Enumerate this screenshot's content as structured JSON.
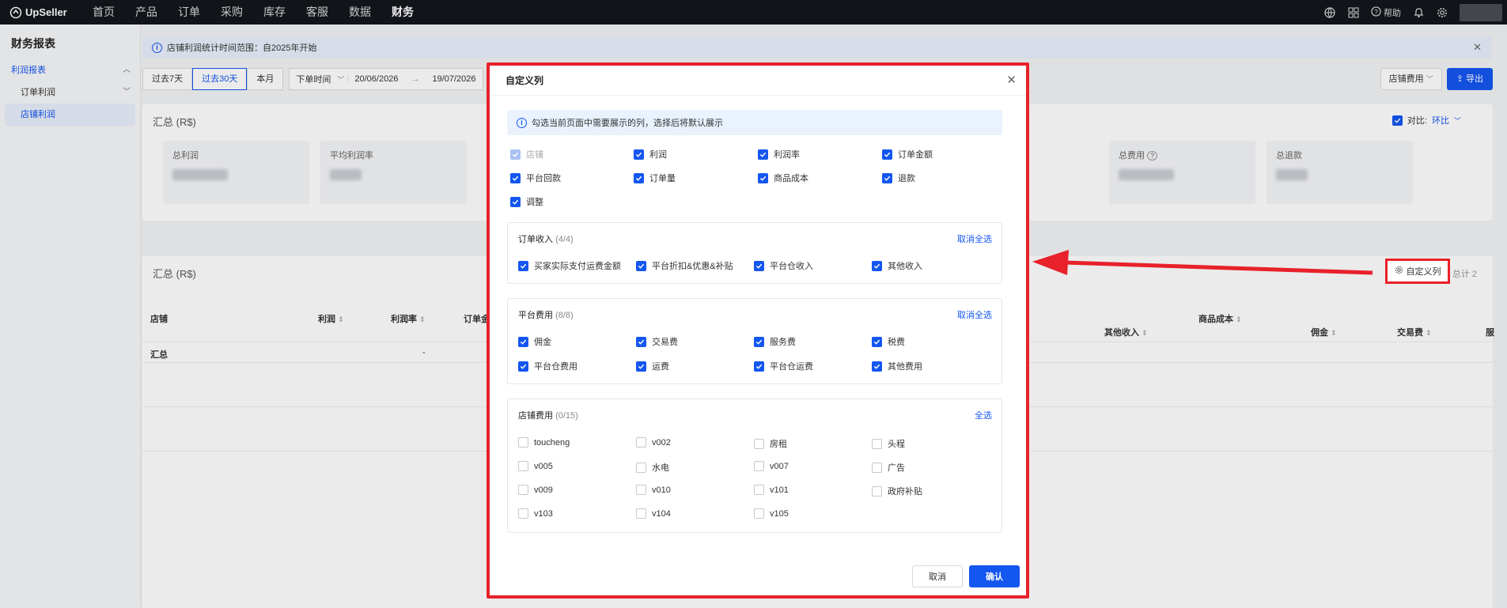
{
  "topbar": {
    "logo": "UpSeller",
    "nav": [
      "首页",
      "产品",
      "订单",
      "采购",
      "库存",
      "客服",
      "数据",
      "财务"
    ],
    "active_nav": "财务",
    "help": "帮助"
  },
  "sidebar": {
    "title": "财务报表",
    "items": [
      {
        "label": "利润报表"
      },
      {
        "label": "订单利润"
      },
      {
        "label": "店铺利润"
      }
    ]
  },
  "notice": {
    "text": "店铺利润统计时间范围：自2025年开始"
  },
  "filters": {
    "btn_7": "过去7天",
    "btn_30": "过去30天",
    "btn_month": "本月",
    "time_type": "下单时间",
    "date_from": "20/06/2026",
    "date_sep": "→",
    "date_to": "19/07/2026",
    "store_fee": "店铺费用",
    "export": "导出"
  },
  "summary": {
    "title": "汇总 (R$)",
    "compare_label": "对比:",
    "compare_value": "环比",
    "tiles": [
      "总利润",
      "平均利润率",
      "总费用",
      "总退款"
    ]
  },
  "table": {
    "title": "汇总 (R$)",
    "custom_columns": "自定义列",
    "total": "总计 2",
    "headers": {
      "store": "店铺",
      "profit": "利润",
      "margin": "利润率",
      "order": "订单金",
      "product_cost": "商品成本",
      "other_income": "其他收入",
      "commission": "佣金",
      "transaction": "交易费",
      "service": "服"
    },
    "summary_row": {
      "label": "汇总",
      "margin": "-"
    }
  },
  "modal": {
    "title": "自定义列",
    "note": "勾选当前页面中需要展示的列，选择后将默认展示",
    "base_columns": [
      {
        "label": "店铺",
        "state": "disabled"
      },
      {
        "label": "利润",
        "state": "checked"
      },
      {
        "label": "利润率",
        "state": "checked"
      },
      {
        "label": "订单金额",
        "state": "checked"
      },
      {
        "label": "平台回款",
        "state": "checked"
      },
      {
        "label": "订单量",
        "state": "checked"
      },
      {
        "label": "商品成本",
        "state": "checked"
      },
      {
        "label": "退款",
        "state": "checked"
      },
      {
        "label": "调整",
        "state": "checked"
      }
    ],
    "groups": [
      {
        "title": "订单收入",
        "count": "(4/4)",
        "action": "取消全选",
        "items": [
          {
            "label": "买家实际支付运费金额",
            "checked": true
          },
          {
            "label": "平台折扣&优惠&补贴",
            "checked": true
          },
          {
            "label": "平台仓收入",
            "checked": true
          },
          {
            "label": "其他收入",
            "checked": true
          }
        ]
      },
      {
        "title": "平台费用",
        "count": "(8/8)",
        "action": "取消全选",
        "items": [
          {
            "label": "佣金",
            "checked": true
          },
          {
            "label": "交易费",
            "checked": true
          },
          {
            "label": "服务费",
            "checked": true
          },
          {
            "label": "税费",
            "checked": true
          },
          {
            "label": "平台仓费用",
            "checked": true
          },
          {
            "label": "运费",
            "checked": true
          },
          {
            "label": "平台仓运费",
            "checked": true
          },
          {
            "label": "其他费用",
            "checked": true
          }
        ]
      },
      {
        "title": "店铺费用",
        "count": "(0/15)",
        "action": "全选",
        "items": [
          {
            "label": "toucheng",
            "checked": false
          },
          {
            "label": "v002",
            "checked": false
          },
          {
            "label": "房租",
            "checked": false
          },
          {
            "label": "头程",
            "checked": false
          },
          {
            "label": "v005",
            "checked": false
          },
          {
            "label": "水电",
            "checked": false
          },
          {
            "label": "v007",
            "checked": false
          },
          {
            "label": "广告",
            "checked": false
          },
          {
            "label": "v009",
            "checked": false
          },
          {
            "label": "v010",
            "checked": false
          },
          {
            "label": "v101",
            "checked": false
          },
          {
            "label": "政府补贴",
            "checked": false
          },
          {
            "label": "v103",
            "checked": false
          },
          {
            "label": "v104",
            "checked": false
          },
          {
            "label": "v105",
            "checked": false
          }
        ]
      }
    ],
    "cancel": "取消",
    "confirm": "确认"
  },
  "colors": {
    "primary": "#1456f0",
    "highlight": "#e8212a",
    "topbar": "#13161c"
  }
}
